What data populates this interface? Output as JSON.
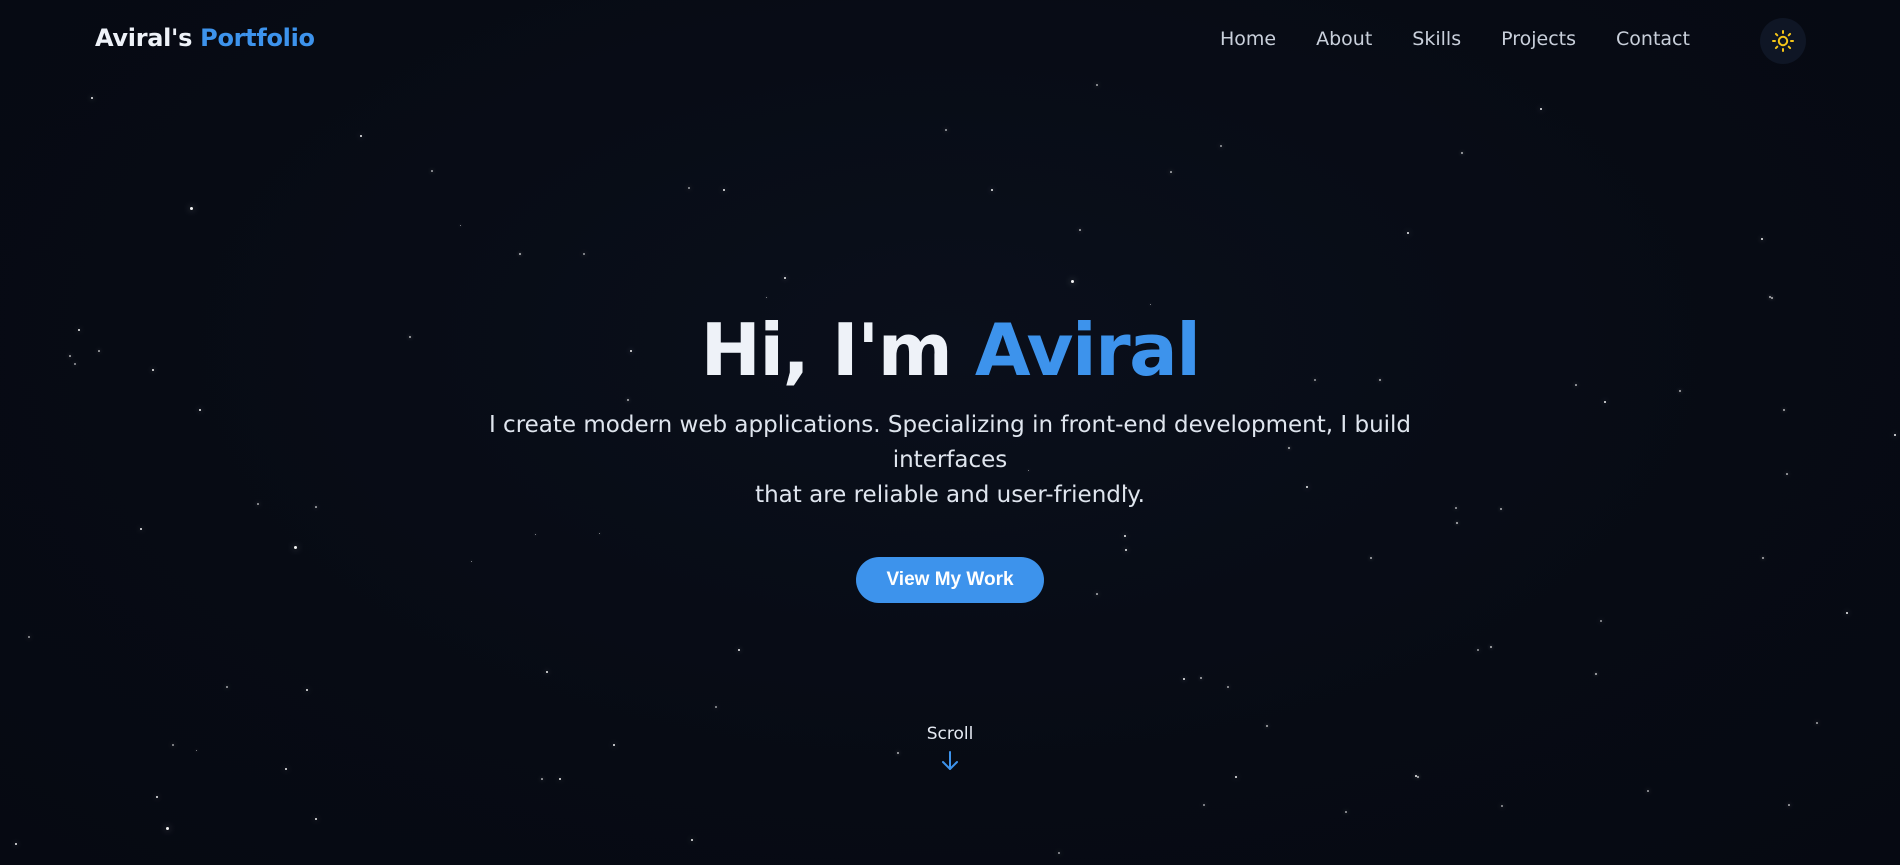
{
  "header": {
    "logo_name": "Aviral's",
    "logo_accent": "Portfolio",
    "nav": {
      "home": "Home",
      "about": "About",
      "skills": "Skills",
      "projects": "Projects",
      "contact": "Contact"
    },
    "theme_toggle_icon": "sun-icon"
  },
  "hero": {
    "title_prefix": "Hi, I'm",
    "title_accent": "Aviral",
    "subtitle_line1": "I create modern web applications. Specializing in front-end development, I build interfaces",
    "subtitle_line2": "that are reliable and user-friendly.",
    "cta_label": "View My Work"
  },
  "scroll": {
    "label": "Scroll",
    "icon": "arrow-down-icon"
  },
  "colors": {
    "background": "#070b14",
    "accent": "#3d93ec",
    "sun": "#f5c518"
  }
}
